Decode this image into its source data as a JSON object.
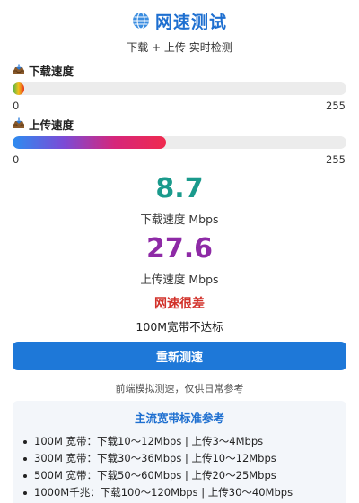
{
  "header": {
    "icon": "globe-icon",
    "title": "网速测试",
    "subtitle": "下载 + 上传 实时检测"
  },
  "download": {
    "icon": "inbox-tray-icon",
    "label": "下载速度",
    "scale_min": "0",
    "scale_max": "255",
    "fill_fraction": 0.034
  },
  "upload": {
    "icon": "inbox-tray-icon",
    "label": "上传速度",
    "scale_min": "0",
    "scale_max": "255",
    "fill_fraction": 0.46
  },
  "readouts": {
    "download_value": "8.7",
    "download_unit": "下载速度 Mbps",
    "upload_value": "27.6",
    "upload_unit": "上传速度 Mbps"
  },
  "verdict": {
    "quality": "网速很差",
    "standard": "100M宽带不达标"
  },
  "actions": {
    "retest_label": "重新测速"
  },
  "note": "前端模拟测速，仅供日常参考",
  "reference": {
    "title": "主流宽带标准参考",
    "items": [
      "100M 宽带：下载10～12Mbps | 上传3～4Mbps",
      "300M 宽带：下载30～36Mbps | 上传10～12Mbps",
      "500M 宽带：下载50～60Mbps | 上传20～25Mbps",
      "1000M千兆：下载100～120Mbps | 上传30～40Mbps"
    ]
  },
  "colors": {
    "accent": "#1e6fd0",
    "download_value": "#1a9a8c",
    "upload_value": "#8e2aa6",
    "warning": "#d2322b"
  }
}
